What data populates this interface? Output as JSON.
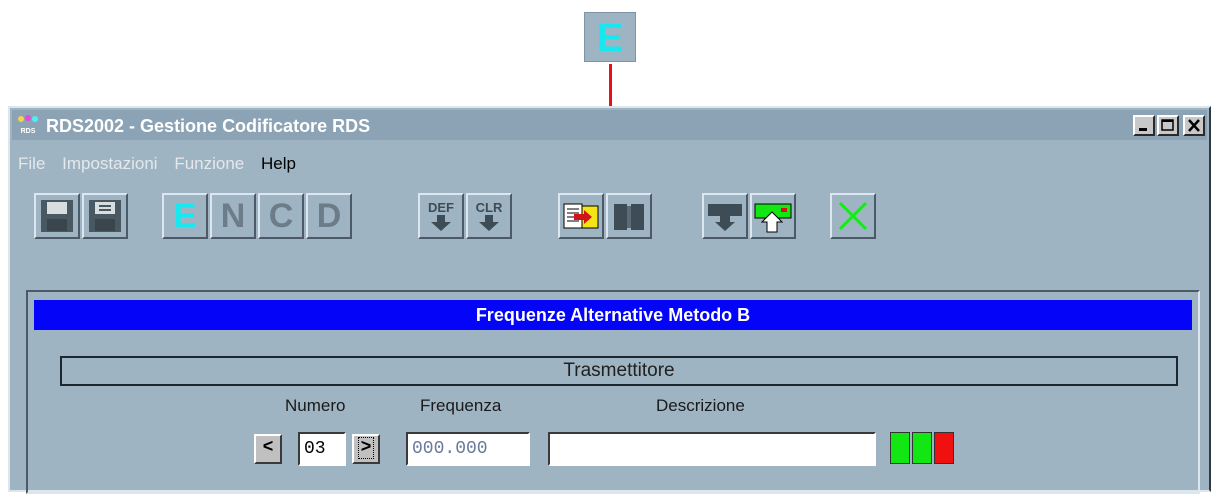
{
  "callout": {
    "letter": "E",
    "letter_color": "#19e7f0",
    "arrow_color": "#e8101a"
  },
  "window": {
    "title": "RDS2002 - Gestione Codificatore RDS",
    "icon": "rds-logo-icon",
    "controls": [
      "minimize-icon",
      "maximize-icon",
      "close-icon"
    ]
  },
  "menu": {
    "items": [
      {
        "label": "File",
        "enabled": false
      },
      {
        "label": "Impostazioni",
        "enabled": false
      },
      {
        "label": "Funzione",
        "enabled": false
      },
      {
        "label": "Help",
        "enabled": true
      }
    ]
  },
  "toolbar": {
    "save_icon": "floppy-disk-icon",
    "save_as_icon": "floppy-disk-icon",
    "mode_e": "E",
    "mode_n": "N",
    "mode_c": "C",
    "mode_d": "D",
    "def_label": "DEF",
    "clr_label": "CLR",
    "import_icon": "import-data-icon",
    "book_icon": "book-icon",
    "download_icon": "download-icon",
    "upload_icon": "upload-icon",
    "exit_icon": "exit-x-icon",
    "mode_e_color": "#19e7f0",
    "exit_color": "#0ef010"
  },
  "panel": {
    "title": "Frequenze Alternative Metodo B",
    "transmitter_label": "Trasmettitore",
    "col_numero": "Numero",
    "col_frequenza": "Frequenza",
    "col_descrizione": "Descrizione",
    "prev_label": "<",
    "next_label": ">",
    "numero_value": "03",
    "frequenza_value": "000.000",
    "descrizione_value": "",
    "indicators": [
      "#13e713",
      "#13e713",
      "#f01010"
    ]
  }
}
